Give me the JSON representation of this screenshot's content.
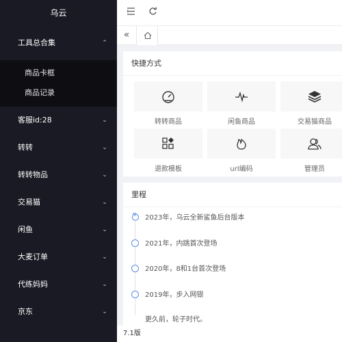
{
  "brand": "乌云",
  "sidebar": {
    "group": {
      "label": "工具总合集",
      "sub": [
        "商品卡框",
        "商品记录"
      ]
    },
    "items": [
      "客服id:28",
      "转转",
      "转转物品",
      "交易猫",
      "闲鱼",
      "大麦订单",
      "代练妈妈",
      "京东"
    ]
  },
  "shortcuts": {
    "title": "快捷方式",
    "items": [
      {
        "label": "转转商品",
        "icon": "gauge-icon"
      },
      {
        "label": "闲鱼商品",
        "icon": "pulse-icon"
      },
      {
        "label": "交易猫商品",
        "icon": "layers-icon"
      },
      {
        "label": "退款模板",
        "icon": "apps-icon"
      },
      {
        "label": "url编码",
        "icon": "fire-icon"
      },
      {
        "label": "管理员",
        "icon": "users-icon"
      }
    ]
  },
  "timeline": {
    "title": "里程",
    "items": [
      "2023年，乌云全新鲨鱼后台版本",
      "2021年，内跳首次登场",
      "2020年，8和1台首次登场",
      "2019年，步入网银",
      "更久前，轮子时代。"
    ]
  },
  "footer": "7.1版"
}
